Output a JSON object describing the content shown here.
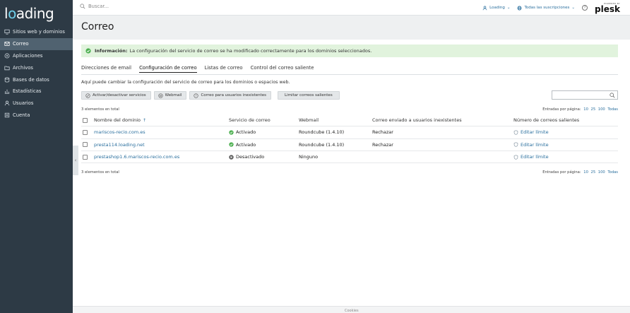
{
  "brand": {
    "logo": "loading",
    "logo_before": "l",
    "logo_accent": "o",
    "logo_after": "ading"
  },
  "sidebar": {
    "items": [
      {
        "label": "Sitios web y dominios",
        "icon": "monitor-icon"
      },
      {
        "label": "Correo",
        "icon": "mail-icon",
        "active": true
      },
      {
        "label": "Aplicaciones",
        "icon": "apps-icon"
      },
      {
        "label": "Archivos",
        "icon": "folder-icon"
      },
      {
        "label": "Bases de datos",
        "icon": "database-icon"
      },
      {
        "label": "Estadísticas",
        "icon": "stats-icon"
      },
      {
        "label": "Usuarios",
        "icon": "user-icon"
      },
      {
        "label": "Cuenta",
        "icon": "account-icon"
      }
    ]
  },
  "topbar": {
    "search_placeholder": "Buscar...",
    "user_label": "Loading",
    "subscriptions_label": "Todas las suscripciones",
    "help_label": "?",
    "powered_by": "POWERED BY",
    "plesk": "plesk"
  },
  "page": {
    "title": "Correo"
  },
  "alert": {
    "label": "Información:",
    "text": "La configuración del servicio de correo se ha modificado correctamente para los dominios seleccionados."
  },
  "tabs": [
    {
      "label": "Direcciones de email"
    },
    {
      "label": "Configuración de correo",
      "active": true
    },
    {
      "label": "Listas de correo"
    },
    {
      "label": "Control del correo saliente"
    }
  ],
  "description": "Aquí puede cambiar la configuración del servicio de correo para los dominios o espacios web.",
  "toolbar": {
    "toggle_services": "Activar/desactivar servicios",
    "webmail": "Webmail",
    "nonexistent_users": "Correo para usuarios inexistentes",
    "limit_outgoing": "Limitar correos salientes"
  },
  "list_info": {
    "count": "3 elementos en total",
    "per_page_label": "Entradas por página:",
    "per_page_options": [
      "10",
      "25",
      "100",
      "Todas"
    ]
  },
  "table": {
    "headers": {
      "domain": "Nombre del dominio",
      "mail_service": "Servicio de correo",
      "webmail": "Webmail",
      "nonexistent": "Correo enviado a usuarios inexistentes",
      "outgoing": "Número de correos salientes"
    },
    "sort_indicator": "↑",
    "rows": [
      {
        "domain": "mariscos-recio.com.es",
        "status": "Activado",
        "status_ok": true,
        "webmail": "Roundcube (1.4.10)",
        "nonexistent": "Rechazar",
        "outgoing": "Editar límite"
      },
      {
        "domain": "presta114.loading.net",
        "status": "Activado",
        "status_ok": true,
        "webmail": "Roundcube (1.4.10)",
        "nonexistent": "Rechazar",
        "outgoing": "Editar límite"
      },
      {
        "domain": "prestashop1.6.mariscos-recio.com.es",
        "status": "Desactivado",
        "status_ok": false,
        "webmail": "Ninguno",
        "nonexistent": "",
        "outgoing": "Editar límite"
      }
    ]
  },
  "footer": {
    "text": "Cookies"
  },
  "colors": {
    "sidebar_bg": "#2d3a45",
    "sidebar_active": "#506270",
    "link": "#2a6f9e",
    "success_bg": "#e1f3dd",
    "success_icon": "#4caf50"
  }
}
